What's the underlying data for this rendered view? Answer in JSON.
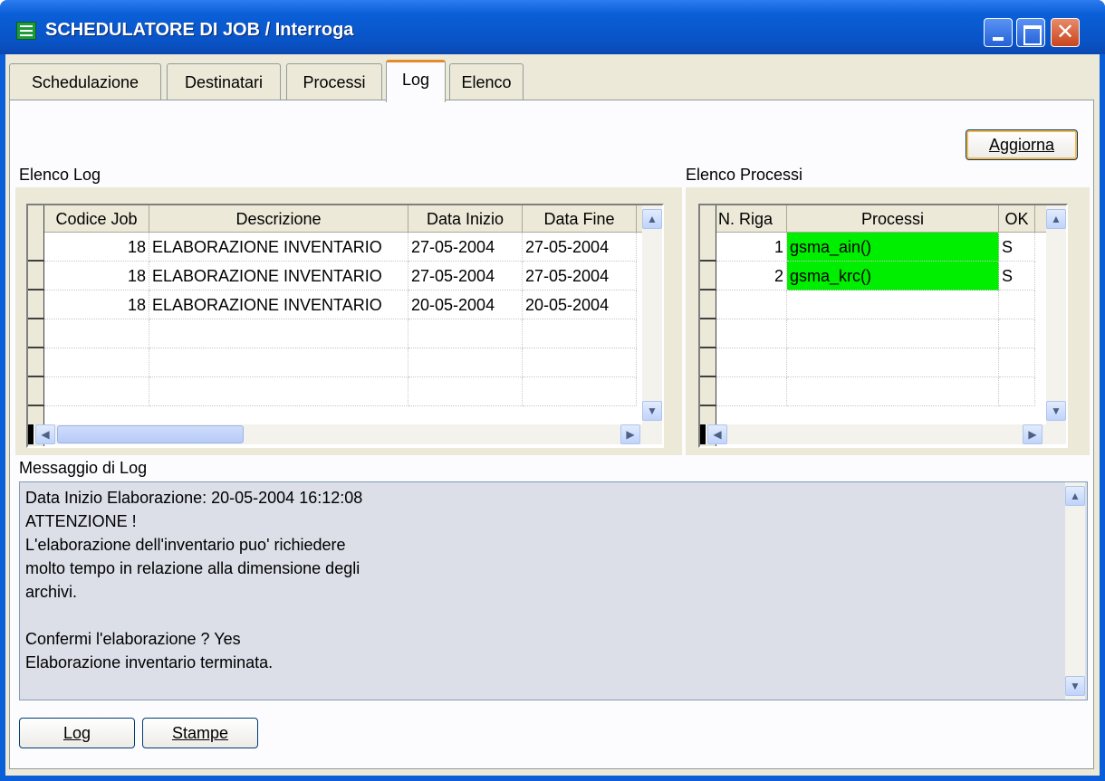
{
  "window": {
    "title": "SCHEDULATORE DI JOB / Interroga"
  },
  "tabs": [
    {
      "label": "Schedulazione"
    },
    {
      "label": "Destinatari"
    },
    {
      "label": "Processi"
    },
    {
      "label": "Log",
      "active": true
    },
    {
      "label": "Elenco"
    }
  ],
  "buttons": {
    "aggiorna": "Aggiorna",
    "log": "Log",
    "stampe": "Stampe"
  },
  "elenco_log": {
    "label": "Elenco Log",
    "columns": [
      "Codice Job",
      "Descrizione",
      "Data Inizio",
      "Data Fine"
    ],
    "rows": [
      [
        "18",
        "ELABORAZIONE INVENTARIO",
        "27-05-2004",
        "27-05-2004"
      ],
      [
        "18",
        "ELABORAZIONE INVENTARIO",
        "27-05-2004",
        "27-05-2004"
      ],
      [
        "18",
        "ELABORAZIONE INVENTARIO",
        "20-05-2004",
        "20-05-2004"
      ]
    ]
  },
  "elenco_processi": {
    "label": "Elenco Processi",
    "columns": [
      "N. Riga",
      "Processi",
      "OK"
    ],
    "rows": [
      [
        "1",
        "gsma_ain()",
        "S"
      ],
      [
        "2",
        "gsma_krc()",
        "S"
      ]
    ]
  },
  "messaggio": {
    "label": "Messaggio di Log",
    "lines": [
      "Data Inizio Elaborazione: 20-05-2004 16:12:08",
      "ATTENZIONE !",
      "L'elaborazione dell'inventario puo' richiedere",
      "molto tempo in relazione alla dimensione degli",
      "archivi.",
      "",
      "Confermi l'elaborazione ? Yes",
      "Elaborazione inventario terminata."
    ]
  },
  "colors": {
    "highlight_cell": "#00ee00",
    "titlebar": "#0a5fd8",
    "active_tab_accent": "#e68b2c"
  },
  "icons": [
    "app-grid-icon",
    "minimize-icon",
    "maximize-icon",
    "close-icon",
    "scroll-up-icon",
    "scroll-down-icon",
    "scroll-left-icon",
    "scroll-right-icon"
  ]
}
